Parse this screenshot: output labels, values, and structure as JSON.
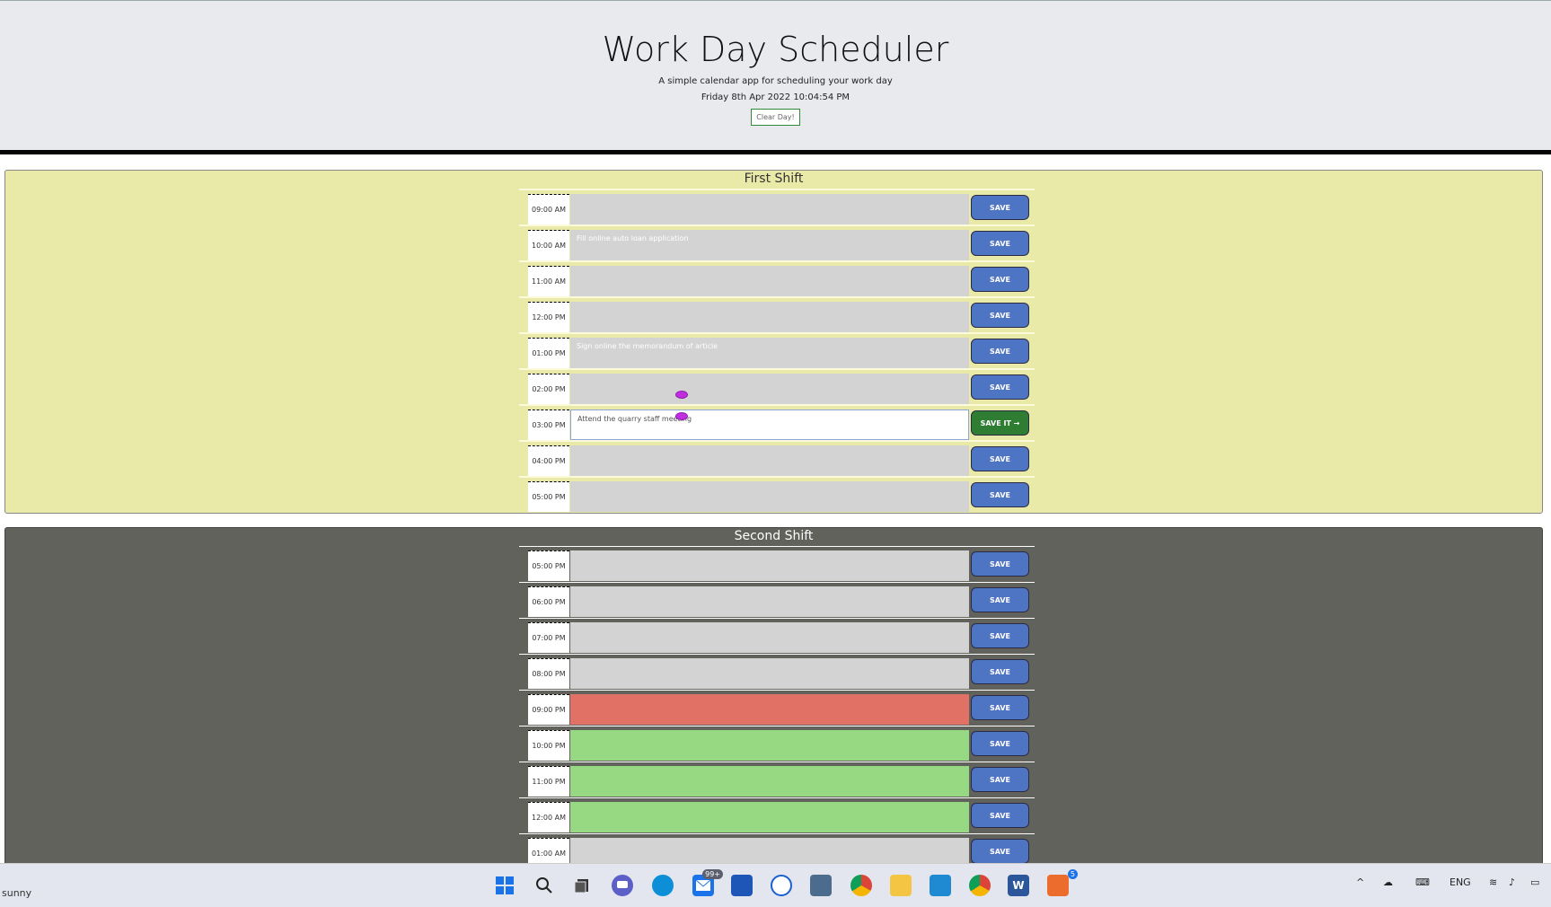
{
  "header": {
    "title": "Work Day Scheduler",
    "subtitle": "A simple calendar app for scheduling your work day",
    "datetime": "Friday 8th Apr 2022 10:04:54 PM",
    "clear_label": "Clear Day!"
  },
  "first_shift": {
    "title": "First Shift",
    "rows": [
      {
        "time": "09:00 AM",
        "text": "",
        "save": "SAVE",
        "state": "normal"
      },
      {
        "time": "10:00 AM",
        "text": "Fill online auto loan application",
        "save": "SAVE",
        "state": "normal"
      },
      {
        "time": "11:00 AM",
        "text": "",
        "save": "SAVE",
        "state": "normal"
      },
      {
        "time": "12:00 PM",
        "text": "",
        "save": "SAVE",
        "state": "normal"
      },
      {
        "time": "01:00 PM",
        "text": "Sign online the memorandum of article",
        "save": "SAVE",
        "state": "normal"
      },
      {
        "time": "02:00 PM",
        "text": "",
        "save": "SAVE",
        "state": "normal"
      },
      {
        "time": "03:00 PM",
        "text": "Attend the  quarry staff meeting",
        "save": "SAVE IT →",
        "state": "active"
      },
      {
        "time": "04:00 PM",
        "text": "",
        "save": "SAVE",
        "state": "normal"
      },
      {
        "time": "05:00 PM",
        "text": "",
        "save": "SAVE",
        "state": "normal"
      }
    ]
  },
  "second_shift": {
    "title": "Second Shift",
    "rows": [
      {
        "time": "05:00 PM",
        "text": "",
        "save": "SAVE",
        "state": "normal"
      },
      {
        "time": "06:00 PM",
        "text": "",
        "save": "SAVE",
        "state": "normal"
      },
      {
        "time": "07:00 PM",
        "text": "",
        "save": "SAVE",
        "state": "normal"
      },
      {
        "time": "08:00 PM",
        "text": "",
        "save": "SAVE",
        "state": "normal"
      },
      {
        "time": "09:00 PM",
        "text": "",
        "save": "SAVE",
        "state": "past"
      },
      {
        "time": "10:00 PM",
        "text": "",
        "save": "SAVE",
        "state": "future"
      },
      {
        "time": "11:00 PM",
        "text": "",
        "save": "SAVE",
        "state": "future"
      },
      {
        "time": "12:00 AM",
        "text": "",
        "save": "SAVE",
        "state": "future"
      },
      {
        "time": "01:00 AM",
        "text": "",
        "save": "SAVE",
        "state": "normal"
      }
    ]
  },
  "colors": {
    "first_shift_bg": "#e9e9a8",
    "second_shift_bg": "#62625c",
    "save_button": "#4e74c4",
    "save_active": "#2e7d32",
    "past": "#e17065",
    "future": "#97d882",
    "empty": "#d3d3d3"
  },
  "taskbar": {
    "weather": "sunny",
    "mail_badge": "99+",
    "app_badge": "5",
    "language": "ENG",
    "icons": [
      "windows-start-icon",
      "search-icon",
      "task-view-icon",
      "teams-chat-icon",
      "edge-icon",
      "mail-icon",
      "store-icon",
      "app-icon",
      "camera-icon",
      "chrome-icon",
      "file-explorer-icon",
      "vscode-icon",
      "chrome-profile-icon",
      "word-icon",
      "office-icon"
    ]
  }
}
